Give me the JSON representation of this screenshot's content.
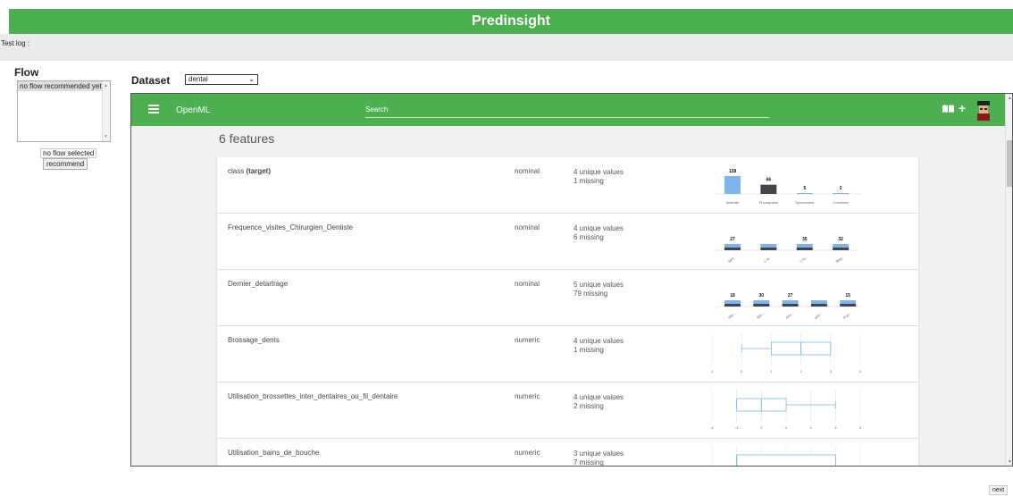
{
  "app": {
    "title": "Predinsight"
  },
  "log": {
    "label": "Test log :"
  },
  "flow": {
    "title": "Flow",
    "list_item": "no flow recommended yet",
    "status": "no flow selected",
    "recommend_label": "recommend"
  },
  "dataset": {
    "label": "Dataset",
    "selected": "dental"
  },
  "openml": {
    "title": "OpenML",
    "search_placeholder": "Search",
    "features_heading": "6 features",
    "icons": [
      "menu-icon",
      "book-icon",
      "plus-icon",
      "avatar"
    ]
  },
  "features": [
    {
      "name": "class",
      "target": "(target)",
      "type": "nominal",
      "unique": "4 unique values",
      "missing": "1 missing",
      "chart": {
        "kind": "bar",
        "labels": [
          "Absente",
          "Provoquees",
          "Spontanees",
          "Correlees"
        ],
        "values": [
          128,
          66,
          5,
          2
        ],
        "colors": [
          "#7cb5ec",
          "#434348",
          "#7cb5ec",
          "#7cb5ec"
        ]
      }
    },
    {
      "name": "Frequence_visites_Chirurgien_Dentiste",
      "type": "nominal",
      "unique": "4 unique values",
      "missing": "6 missing",
      "chart": {
        "kind": "stacked",
        "labels": [
          "Jam...",
          "1 fo...",
          "2 fo...",
          "Reg..."
        ],
        "values": [
          27,
          0,
          35,
          32
        ]
      }
    },
    {
      "name": "Dernier_detartrage",
      "type": "nominal",
      "unique": "5 unique values",
      "missing": "79 missing",
      "chart": {
        "kind": "stacked",
        "labels": [
          "mai...",
          "Bot...",
          "moi...",
          "ann...",
          "Pus..."
        ],
        "values": [
          18,
          30,
          27,
          0,
          15
        ]
      }
    },
    {
      "name": "Brossage_dents",
      "type": "numeric",
      "unique": "4 unique values",
      "missing": "1 missing",
      "chart": {
        "kind": "box",
        "ticks": [
          "-1",
          "0",
          "1",
          "2",
          "3",
          "4"
        ],
        "min": 0,
        "q1": 1,
        "median": 2,
        "q3": 3,
        "max": 3
      }
    },
    {
      "name": "Utilisation_brossettes_inter_dentaires_ou_fil_dentaire",
      "type": "numeric",
      "unique": "4 unique values",
      "missing": "2 missing",
      "chart": {
        "kind": "box",
        "ticks": [
          "-2",
          "-1",
          "0",
          "1",
          "2",
          "3",
          "4"
        ],
        "min": -1,
        "q1": -1,
        "median": 0,
        "q3": 1,
        "max": 3
      }
    },
    {
      "name": "Utilisation_bains_de_bouche",
      "type": "numeric",
      "unique": "3 unique values",
      "missing": "7 missing",
      "chart": {
        "kind": "box",
        "ticks": [],
        "min": -1,
        "q1": -1,
        "median": -1,
        "q3": 3,
        "max": 3
      }
    }
  ],
  "footer": {
    "next_label": "next"
  }
}
